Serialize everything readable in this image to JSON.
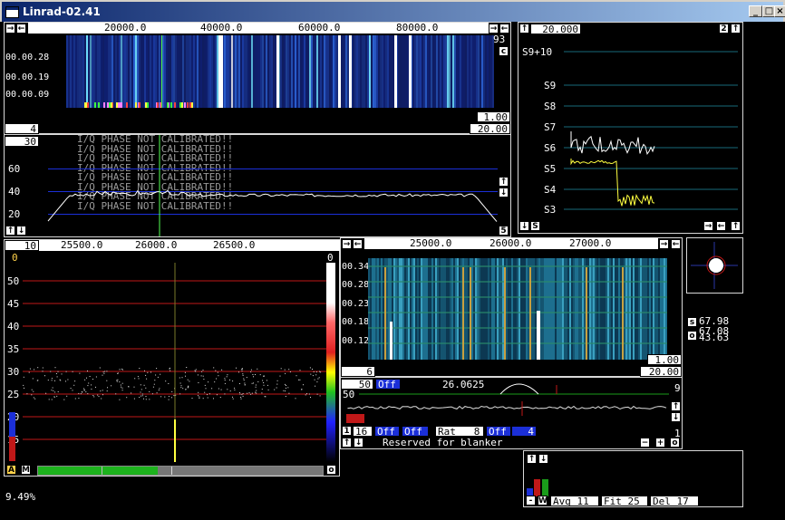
{
  "window": {
    "title": "Linrad-02.41",
    "min_icon": "minimize-icon",
    "max_icon": "maximize-icon",
    "close_icon": "close-icon"
  },
  "wide_waterfall": {
    "freq_ticks": [
      "20000.0",
      "40000.0",
      "60000.0",
      "80000.0"
    ],
    "time_labels": [
      "00.00.28",
      "00.00.19",
      "00.00.09"
    ],
    "right_val": "93",
    "c_button": "c",
    "avgn": "4",
    "gain": "1.00",
    "zero": "20.00"
  },
  "wide_spectrum": {
    "avgn": "30",
    "y_labels": [
      "60",
      "40",
      "20"
    ],
    "phase_warning": "I/Q PHASE NOT CALIBRATED!!",
    "warn_rows": [
      "I/Q PHASE NOT CALIBRATED!!",
      "I/Q PHASE NOT CALIBRATED!!",
      "I/Q PHASE NOT CALIBRATED!!",
      "I/Q PHASE NOT CALIBRATED!!",
      "I/Q PHASE NOT CALIBRATED!!",
      "I/Q PHASE NOT CALIBRATED!!",
      "I/Q PHASE NOT CALIBRATED!!",
      "I/Q PHASE NOT CALIBRATED!!"
    ],
    "right_val": "5"
  },
  "smeter": {
    "time_val": "20.000",
    "right_val": "2",
    "levels": [
      "S9+10",
      "S9",
      "S8",
      "S7",
      "S6",
      "S5",
      "S4",
      "S3"
    ],
    "s_button": "S"
  },
  "baseband": {
    "left_val": "10",
    "freq_ticks": [
      "25500.0",
      "26000.0",
      "26500.0"
    ],
    "top_left": "0",
    "top_right": "0",
    "y_labels": [
      "50",
      "45",
      "40",
      "35",
      "30",
      "25",
      "20",
      "15"
    ],
    "a_button": "A",
    "m_button": "M",
    "o_button": "o"
  },
  "hires_waterfall": {
    "freq_ticks": [
      "25000.0",
      "26000.0",
      "27000.0"
    ],
    "time_labels": [
      "00.34",
      "00.28",
      "00.23",
      "00.18",
      "00.12"
    ],
    "avgn": "6",
    "gain": "1.00",
    "zero": "20.00"
  },
  "afc": {
    "val50": "50",
    "off1": "Off",
    "freq": "26.0625",
    "nine": "9",
    "fifty": "50",
    "one": "1",
    "sixteen": "16",
    "off2": "Off",
    "off3": "Off",
    "rat": "Rat",
    "rat_val": "8",
    "off4": "Off",
    "four": "4",
    "blanker": "Reserved for blanker"
  },
  "pol": {
    "s_val": "67.98",
    "mid_val": "67.08",
    "o_val": "43.63",
    "s_btn": "s",
    "o_btn": "o"
  },
  "coherent": {
    "avg_label": "Avg",
    "avg_val": "11",
    "fit_label": "Fit",
    "fit_val": "25",
    "del_label": "Del",
    "del_val": "17",
    "w_button": "W",
    "minus": "-"
  },
  "cpu": "9.49%",
  "colors": {
    "accent": "#1b2fd8",
    "grid_red": "#c01818",
    "trace": "#ffffff",
    "meter": "#ffff40"
  }
}
